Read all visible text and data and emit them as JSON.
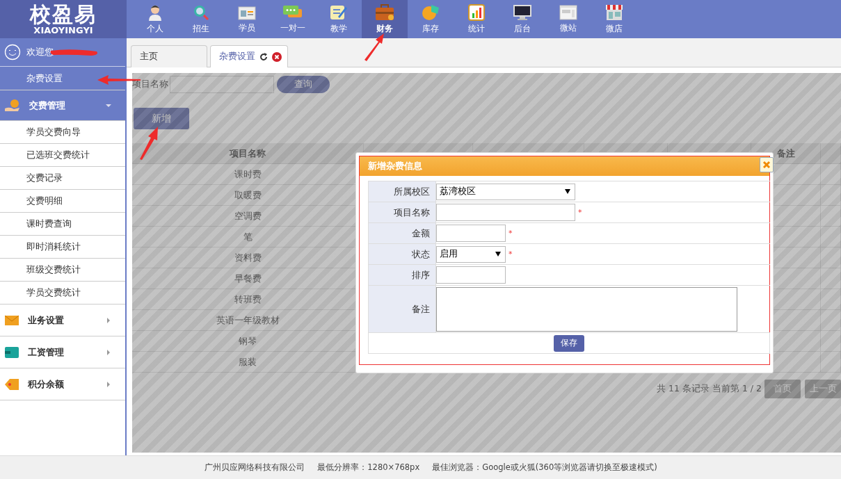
{
  "logo": {
    "title": "校盈易",
    "subtitle": "XIAOYINGYI"
  },
  "nav": [
    {
      "label": "个人",
      "selected": false
    },
    {
      "label": "招生",
      "selected": false
    },
    {
      "label": "学员",
      "selected": false
    },
    {
      "label": "一对一",
      "selected": false
    },
    {
      "label": "教学",
      "selected": false
    },
    {
      "label": "财务",
      "selected": true
    },
    {
      "label": "库存",
      "selected": false
    },
    {
      "label": "统计",
      "selected": false
    },
    {
      "label": "后台",
      "selected": false
    },
    {
      "label": "微站",
      "selected": false
    },
    {
      "label": "微店",
      "selected": false
    }
  ],
  "sidebar": {
    "welcome": "欢迎您",
    "items": [
      {
        "label": "杂费设置",
        "selected": true
      }
    ],
    "sections": [
      {
        "label": "交费管理",
        "expanded": true,
        "children": [
          {
            "label": "学员交费向导"
          },
          {
            "label": "已选班交费统计"
          },
          {
            "label": "交费记录"
          },
          {
            "label": "交费明细"
          },
          {
            "label": "课时费查询"
          },
          {
            "label": "即时消耗统计"
          },
          {
            "label": "班级交费统计"
          },
          {
            "label": "学员交费统计"
          }
        ]
      },
      {
        "label": "业务设置",
        "expanded": false
      },
      {
        "label": "工资管理",
        "expanded": false
      },
      {
        "label": "积分余额",
        "expanded": false
      }
    ]
  },
  "tabs": [
    {
      "label": "主页",
      "selected": false,
      "closable": false
    },
    {
      "label": "杂费设置",
      "selected": true,
      "closable": true
    }
  ],
  "search": {
    "label": "项目名称",
    "button": "查询"
  },
  "add_button": "新增",
  "table": {
    "columns": [
      "项目名称",
      "备注"
    ],
    "rows": [
      "课时费",
      "取暖费",
      "空调费",
      "笔",
      "资料费",
      "早餐费",
      "转班费",
      "英语一年级教材",
      "钢琴",
      "服装"
    ]
  },
  "pagination": {
    "summary": "共 11 条记录 当前第 1 / 2",
    "buttons": [
      "首页",
      "上一页"
    ]
  },
  "dialog": {
    "title": "新增杂费信息",
    "fields": [
      {
        "label": "所属校区",
        "kind": "select",
        "value": "荔湾校区"
      },
      {
        "label": "项目名称",
        "kind": "text",
        "required_mark": "*"
      },
      {
        "label": "金额",
        "kind": "text",
        "required_mark": "*"
      },
      {
        "label": "状态",
        "kind": "select",
        "value": "启用",
        "required_mark": "*"
      },
      {
        "label": "排序",
        "kind": "text"
      },
      {
        "label": "备注",
        "kind": "textarea"
      }
    ],
    "button": "保存"
  },
  "footer": [
    "广州贝应网络科技有限公司",
    "最低分辨率：1280×768px",
    "最佳浏览器：Google或火狐(360等浏览器请切换至极速模式)"
  ]
}
